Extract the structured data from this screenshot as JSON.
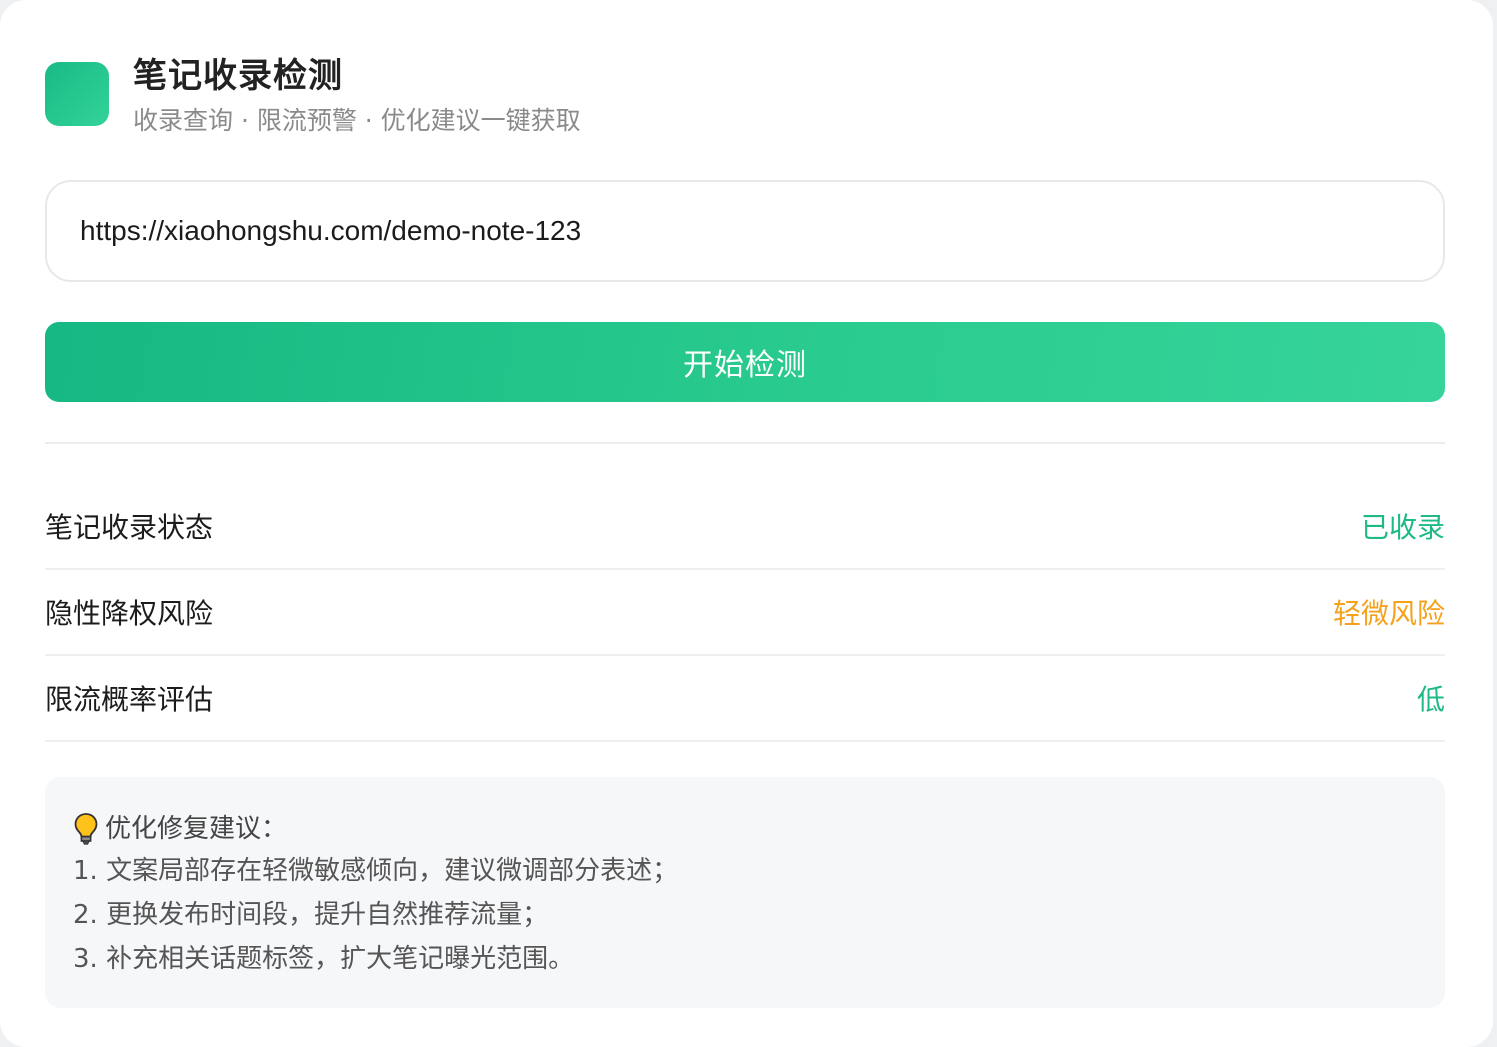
{
  "header": {
    "title": "笔记收录检测",
    "subtitle": "收录查询 · 限流预警 · 优化建议一键获取"
  },
  "url_input": {
    "value": "https://xiaohongshu.com/demo-note-123"
  },
  "start_button": {
    "label": "开始检测"
  },
  "results": [
    {
      "label": "笔记收录状态",
      "value": "已收录",
      "color": "#1fb985"
    },
    {
      "label": "隐性降权风险",
      "value": "轻微风险",
      "color": "#f5a11c"
    },
    {
      "label": "限流概率评估",
      "value": "低",
      "color": "#1fb985"
    }
  ],
  "tips": {
    "icon": "lightbulb-icon",
    "title": "优化修复建议：",
    "items": [
      "1. 文案局部存在轻微敏感倾向，建议微调部分表述；",
      "2. 更换发布时间段，提升自然推荐流量；",
      "3. 补充相关话题标签，扩大笔记曝光范围。"
    ]
  },
  "colors": {
    "accent": "#1fb985",
    "warning": "#f5a11c"
  }
}
